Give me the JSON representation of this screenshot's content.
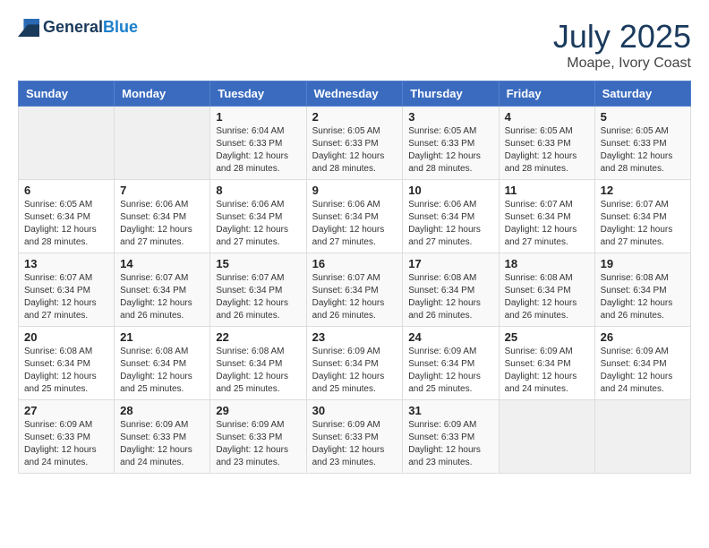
{
  "header": {
    "logo_general": "General",
    "logo_blue": "Blue",
    "month": "July 2025",
    "location": "Moape, Ivory Coast"
  },
  "weekdays": [
    "Sunday",
    "Monday",
    "Tuesday",
    "Wednesday",
    "Thursday",
    "Friday",
    "Saturday"
  ],
  "weeks": [
    [
      {
        "day": "",
        "sunrise": "",
        "sunset": "",
        "daylight": ""
      },
      {
        "day": "",
        "sunrise": "",
        "sunset": "",
        "daylight": ""
      },
      {
        "day": "1",
        "sunrise": "Sunrise: 6:04 AM",
        "sunset": "Sunset: 6:33 PM",
        "daylight": "Daylight: 12 hours and 28 minutes."
      },
      {
        "day": "2",
        "sunrise": "Sunrise: 6:05 AM",
        "sunset": "Sunset: 6:33 PM",
        "daylight": "Daylight: 12 hours and 28 minutes."
      },
      {
        "day": "3",
        "sunrise": "Sunrise: 6:05 AM",
        "sunset": "Sunset: 6:33 PM",
        "daylight": "Daylight: 12 hours and 28 minutes."
      },
      {
        "day": "4",
        "sunrise": "Sunrise: 6:05 AM",
        "sunset": "Sunset: 6:33 PM",
        "daylight": "Daylight: 12 hours and 28 minutes."
      },
      {
        "day": "5",
        "sunrise": "Sunrise: 6:05 AM",
        "sunset": "Sunset: 6:33 PM",
        "daylight": "Daylight: 12 hours and 28 minutes."
      }
    ],
    [
      {
        "day": "6",
        "sunrise": "Sunrise: 6:05 AM",
        "sunset": "Sunset: 6:34 PM",
        "daylight": "Daylight: 12 hours and 28 minutes."
      },
      {
        "day": "7",
        "sunrise": "Sunrise: 6:06 AM",
        "sunset": "Sunset: 6:34 PM",
        "daylight": "Daylight: 12 hours and 27 minutes."
      },
      {
        "day": "8",
        "sunrise": "Sunrise: 6:06 AM",
        "sunset": "Sunset: 6:34 PM",
        "daylight": "Daylight: 12 hours and 27 minutes."
      },
      {
        "day": "9",
        "sunrise": "Sunrise: 6:06 AM",
        "sunset": "Sunset: 6:34 PM",
        "daylight": "Daylight: 12 hours and 27 minutes."
      },
      {
        "day": "10",
        "sunrise": "Sunrise: 6:06 AM",
        "sunset": "Sunset: 6:34 PM",
        "daylight": "Daylight: 12 hours and 27 minutes."
      },
      {
        "day": "11",
        "sunrise": "Sunrise: 6:07 AM",
        "sunset": "Sunset: 6:34 PM",
        "daylight": "Daylight: 12 hours and 27 minutes."
      },
      {
        "day": "12",
        "sunrise": "Sunrise: 6:07 AM",
        "sunset": "Sunset: 6:34 PM",
        "daylight": "Daylight: 12 hours and 27 minutes."
      }
    ],
    [
      {
        "day": "13",
        "sunrise": "Sunrise: 6:07 AM",
        "sunset": "Sunset: 6:34 PM",
        "daylight": "Daylight: 12 hours and 27 minutes."
      },
      {
        "day": "14",
        "sunrise": "Sunrise: 6:07 AM",
        "sunset": "Sunset: 6:34 PM",
        "daylight": "Daylight: 12 hours and 26 minutes."
      },
      {
        "day": "15",
        "sunrise": "Sunrise: 6:07 AM",
        "sunset": "Sunset: 6:34 PM",
        "daylight": "Daylight: 12 hours and 26 minutes."
      },
      {
        "day": "16",
        "sunrise": "Sunrise: 6:07 AM",
        "sunset": "Sunset: 6:34 PM",
        "daylight": "Daylight: 12 hours and 26 minutes."
      },
      {
        "day": "17",
        "sunrise": "Sunrise: 6:08 AM",
        "sunset": "Sunset: 6:34 PM",
        "daylight": "Daylight: 12 hours and 26 minutes."
      },
      {
        "day": "18",
        "sunrise": "Sunrise: 6:08 AM",
        "sunset": "Sunset: 6:34 PM",
        "daylight": "Daylight: 12 hours and 26 minutes."
      },
      {
        "day": "19",
        "sunrise": "Sunrise: 6:08 AM",
        "sunset": "Sunset: 6:34 PM",
        "daylight": "Daylight: 12 hours and 26 minutes."
      }
    ],
    [
      {
        "day": "20",
        "sunrise": "Sunrise: 6:08 AM",
        "sunset": "Sunset: 6:34 PM",
        "daylight": "Daylight: 12 hours and 25 minutes."
      },
      {
        "day": "21",
        "sunrise": "Sunrise: 6:08 AM",
        "sunset": "Sunset: 6:34 PM",
        "daylight": "Daylight: 12 hours and 25 minutes."
      },
      {
        "day": "22",
        "sunrise": "Sunrise: 6:08 AM",
        "sunset": "Sunset: 6:34 PM",
        "daylight": "Daylight: 12 hours and 25 minutes."
      },
      {
        "day": "23",
        "sunrise": "Sunrise: 6:09 AM",
        "sunset": "Sunset: 6:34 PM",
        "daylight": "Daylight: 12 hours and 25 minutes."
      },
      {
        "day": "24",
        "sunrise": "Sunrise: 6:09 AM",
        "sunset": "Sunset: 6:34 PM",
        "daylight": "Daylight: 12 hours and 25 minutes."
      },
      {
        "day": "25",
        "sunrise": "Sunrise: 6:09 AM",
        "sunset": "Sunset: 6:34 PM",
        "daylight": "Daylight: 12 hours and 24 minutes."
      },
      {
        "day": "26",
        "sunrise": "Sunrise: 6:09 AM",
        "sunset": "Sunset: 6:34 PM",
        "daylight": "Daylight: 12 hours and 24 minutes."
      }
    ],
    [
      {
        "day": "27",
        "sunrise": "Sunrise: 6:09 AM",
        "sunset": "Sunset: 6:33 PM",
        "daylight": "Daylight: 12 hours and 24 minutes."
      },
      {
        "day": "28",
        "sunrise": "Sunrise: 6:09 AM",
        "sunset": "Sunset: 6:33 PM",
        "daylight": "Daylight: 12 hours and 24 minutes."
      },
      {
        "day": "29",
        "sunrise": "Sunrise: 6:09 AM",
        "sunset": "Sunset: 6:33 PM",
        "daylight": "Daylight: 12 hours and 23 minutes."
      },
      {
        "day": "30",
        "sunrise": "Sunrise: 6:09 AM",
        "sunset": "Sunset: 6:33 PM",
        "daylight": "Daylight: 12 hours and 23 minutes."
      },
      {
        "day": "31",
        "sunrise": "Sunrise: 6:09 AM",
        "sunset": "Sunset: 6:33 PM",
        "daylight": "Daylight: 12 hours and 23 minutes."
      },
      {
        "day": "",
        "sunrise": "",
        "sunset": "",
        "daylight": ""
      },
      {
        "day": "",
        "sunrise": "",
        "sunset": "",
        "daylight": ""
      }
    ]
  ]
}
